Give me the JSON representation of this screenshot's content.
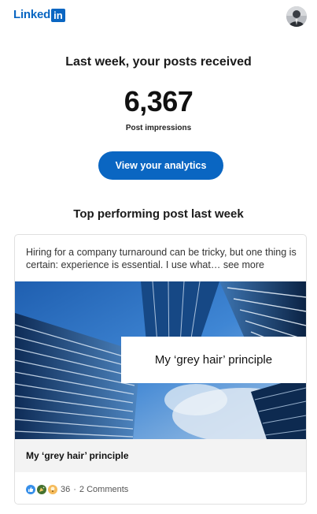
{
  "header": {
    "logo_text": "Linked",
    "logo_box": "in",
    "avatar": "profile-avatar"
  },
  "summary": {
    "headline": "Last week, your posts received",
    "impressions": "6,367",
    "impressions_label": "Post impressions",
    "cta_label": "View your analytics"
  },
  "top_post": {
    "section_title": "Top performing post last week",
    "text": "Hiring for a company turnaround can be tricky, but one thing is certain: experience is essential. I use what…",
    "see_more": "see more",
    "image_overlay": "My ‘grey hair’ principle",
    "link_title": "My ‘grey hair’ principle",
    "reaction_count": "36",
    "separator": "·",
    "comments": "2 Comments",
    "reaction_icons": [
      "like-icon",
      "celebrate-icon",
      "insightful-icon"
    ]
  },
  "colors": {
    "brand": "#0a66c2",
    "card_border": "#e0e0e0",
    "title_bar": "#f3f3f3"
  }
}
